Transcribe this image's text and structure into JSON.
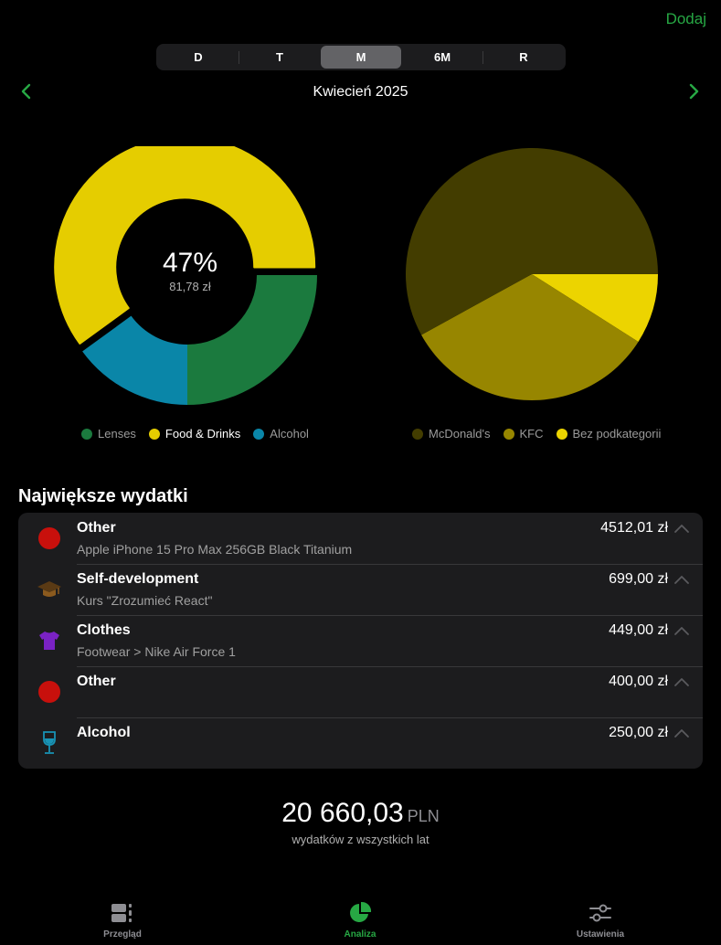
{
  "header": {
    "add_label": "Dodaj",
    "month_title": "Kwiecień 2025"
  },
  "segments": [
    {
      "label": "D",
      "active": false
    },
    {
      "label": "T",
      "active": false
    },
    {
      "label": "M",
      "active": true
    },
    {
      "label": "6M",
      "active": false
    },
    {
      "label": "R",
      "active": false
    }
  ],
  "donut": {
    "percent_label": "47%",
    "amount_label": "81,78 zł"
  },
  "chart_data": [
    {
      "type": "pie",
      "variant": "donut",
      "slices": [
        {
          "name": "Lenses",
          "value": 25,
          "color": "#1b7a3e"
        },
        {
          "name": "Alcohol",
          "value": 15,
          "color": "#0a86a8"
        },
        {
          "name": "Food & Drinks",
          "value": 60,
          "color": "#e5cd00"
        }
      ],
      "start_angle_deg": 0,
      "highlighted": "Food & Drinks",
      "legend": {
        "position": "bottom",
        "entries": [
          "Lenses",
          "Food & Drinks",
          "Alcohol"
        ]
      }
    },
    {
      "type": "pie",
      "slices": [
        {
          "name": "Bez podkategorii",
          "value": 9,
          "color": "#ecd400"
        },
        {
          "name": "KFC",
          "value": 33,
          "color": "#978600"
        },
        {
          "name": "McDonald's",
          "value": 58,
          "color": "#433d00"
        }
      ],
      "start_angle_deg": 0,
      "legend": {
        "position": "bottom",
        "entries": [
          "McDonald's",
          "KFC",
          "Bez podkategorii"
        ]
      }
    }
  ],
  "section_title": "Największe wydatki",
  "expenses": [
    {
      "category": "Other",
      "description": "Apple iPhone 15 Pro Max 256GB Black Titanium",
      "amount": "4512,01 zł",
      "icon": "red-circle-icon",
      "icon_color": "#c8100c"
    },
    {
      "category": "Self-development",
      "description": "Kurs \"Zrozumieć React\"",
      "amount": "699,00 zł",
      "icon": "graduation-cap-icon",
      "icon_color": "#8b5a1e"
    },
    {
      "category": "Clothes",
      "description": "Footwear > Nike Air Force 1",
      "amount": "449,00 zł",
      "icon": "tshirt-icon",
      "icon_color": "#7a22c4"
    },
    {
      "category": "Other",
      "description": "",
      "amount": "400,00 zł",
      "icon": "red-circle-icon",
      "icon_color": "#c8100c"
    },
    {
      "category": "Alcohol",
      "description": "",
      "amount": "250,00 zł",
      "icon": "wine-glass-icon",
      "icon_color": "#1893b5"
    }
  ],
  "total": {
    "amount": "20 660,03",
    "currency": "PLN",
    "caption": "wydatków z wszystkich lat"
  },
  "tabbar": [
    {
      "label": "Przegląd",
      "icon": "overview-icon",
      "active": false
    },
    {
      "label": "Analiza",
      "icon": "pie-chart-icon",
      "active": true
    },
    {
      "label": "Ustawienia",
      "icon": "sliders-icon",
      "active": false
    }
  ],
  "colors": {
    "accent": "#27a844",
    "background": "#000000",
    "card": "#1c1c1e"
  }
}
